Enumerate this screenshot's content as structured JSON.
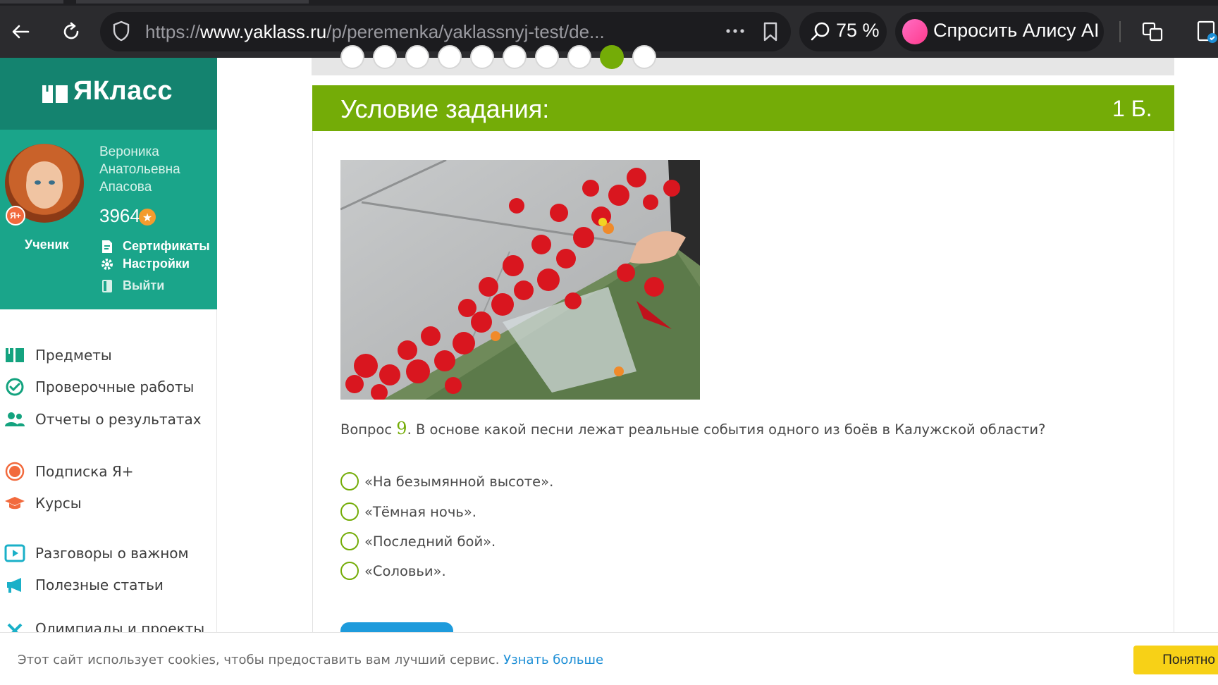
{
  "browser": {
    "url_prefix": "https://",
    "url_host": "www.yaklass.ru",
    "url_path": "/p/peremenka/yaklassnyj-test/de...",
    "zoom": "75 %",
    "alice_label": "Спросить Алису AI",
    "icons": [
      "back-icon",
      "reload-icon",
      "shield-icon",
      "more-icon",
      "bookmark-icon",
      "zoom-search-icon",
      "alice-icon",
      "translate-icon",
      "extension-icon"
    ]
  },
  "sidebar": {
    "logo": "ЯКласс",
    "user": {
      "name_lines": [
        "Вероника",
        "Анатольевна",
        "Апасова"
      ],
      "points": "3964",
      "role": "Ученик",
      "badge": "Я+"
    },
    "profile_links": [
      {
        "label": "Сертификаты",
        "icon": "certificate-icon"
      },
      {
        "label": "Настройки",
        "icon": "gear-icon"
      },
      {
        "label": "Выйти",
        "icon": "logout-icon"
      }
    ],
    "menu": [
      {
        "label": "Предметы",
        "icon": "book-icon",
        "color": "#14a37f"
      },
      {
        "label": "Проверочные работы",
        "icon": "check-circle-icon",
        "color": "#14a37f"
      },
      {
        "label": "Отчеты о результатах",
        "icon": "users-icon",
        "color": "#14a37f"
      },
      {
        "label": "Подписка Я+",
        "icon": "subscription-icon",
        "color": "#f26a3d"
      },
      {
        "label": "Курсы",
        "icon": "graduation-cap-icon",
        "color": "#f26a3d"
      },
      {
        "label": "Разговоры о важном",
        "icon": "play-icon",
        "color": "#1ab0c8"
      },
      {
        "label": "Полезные статьи",
        "icon": "megaphone-icon",
        "color": "#1ab0c8"
      },
      {
        "label": "Олимпиады и проекты",
        "icon": "olympiad-icon",
        "color": "#1ab0c8"
      }
    ]
  },
  "task": {
    "header": "Условие задания:",
    "points": "1 Б.",
    "question_prefix": "Вопрос ",
    "question_number": "9",
    "question_text": ". В основе какой песни лежат реальные события одного из боёв в Калужской области?",
    "options": [
      "«На безымянной высоте».",
      "«Тёмная ночь».",
      "«Последний бой».",
      "«Соловьи»."
    ],
    "steps_total": 10,
    "steps_active_index": 8
  },
  "cookie": {
    "text": "Этот сайт использует cookies, чтобы предоставить вам лучший сервис.",
    "link": "Узнать больше",
    "button": "Понятно"
  },
  "colors": {
    "accent_green": "#74ac07",
    "sidebar_teal": "#1aa58a",
    "sidebar_dark_teal": "#14836f",
    "link_blue": "#1e8fd6",
    "cookie_yellow": "#f7d117"
  }
}
